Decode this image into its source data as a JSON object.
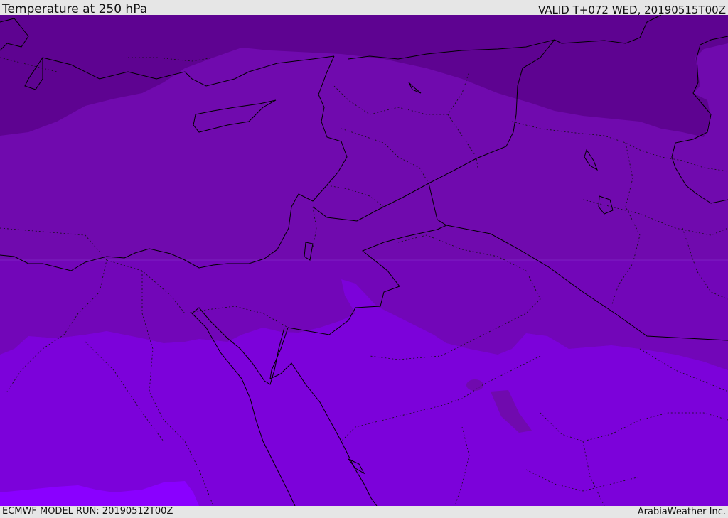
{
  "header": {
    "title": "Temperature at 250 hPa",
    "valid": "VALID T+072 WED, 20190515T00Z"
  },
  "footer": {
    "model_run": "ECMWF MODEL RUN: 20190512T00Z",
    "credit": "ArabiaWeather Inc."
  },
  "map": {
    "colors": {
      "coldest_band": "#5e0391",
      "cold_band": "#700aae",
      "mid_band": "#7c02da",
      "warm_band": "#8a00ff",
      "coast_line": "#000000"
    }
  }
}
